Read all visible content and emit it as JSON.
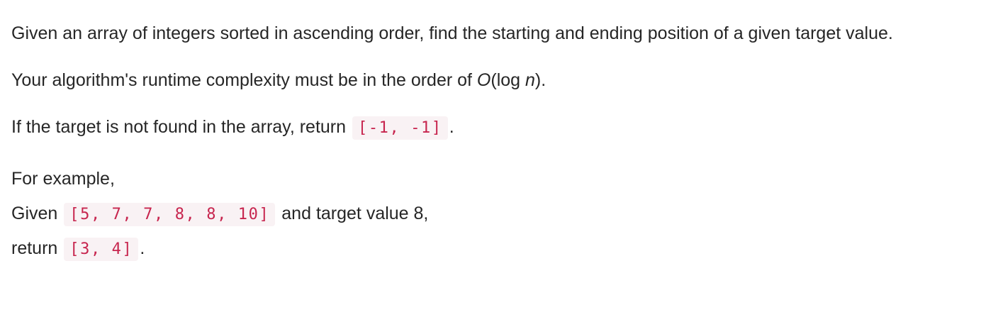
{
  "problem": {
    "p1": "Given an array of integers sorted in ascending order, find the starting and ending position of a given target value.",
    "p2": {
      "before": "Your algorithm's runtime complexity must be in the order of ",
      "o": "O",
      "paren_open": "(log ",
      "n": "n",
      "after": ")."
    },
    "p3": {
      "before": "If the target is not found in the array, return ",
      "code": "[-1, -1]",
      "after": "."
    },
    "example": {
      "intro": "For example,",
      "given_label": "Given",
      "array_code": "[5, 7, 7, 8, 8, 10]",
      "given_after": "and target value 8,",
      "return_label": "return",
      "result_code": "[3, 4]",
      "return_after": "."
    }
  }
}
